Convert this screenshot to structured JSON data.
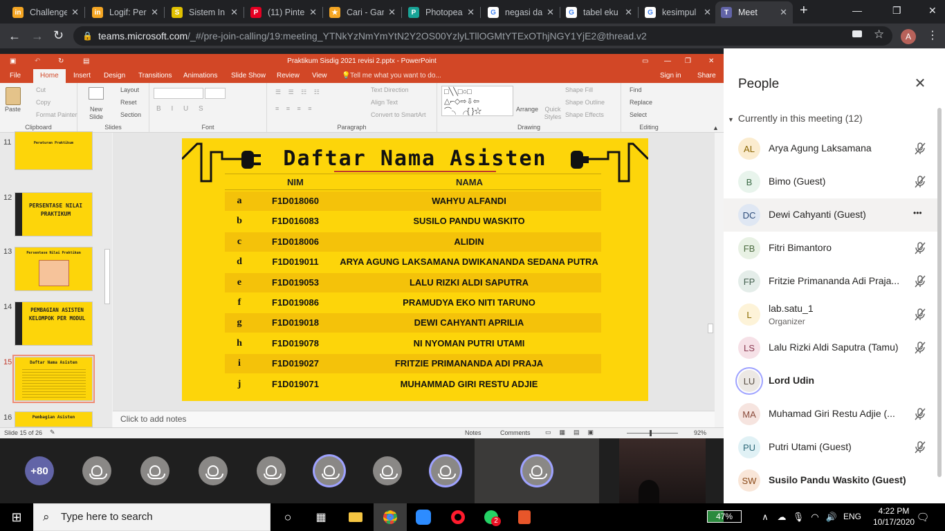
{
  "browser": {
    "tabs": [
      {
        "label": "Challenge",
        "favicon": "in",
        "color": "#f5a623"
      },
      {
        "label": "Logif: Per",
        "favicon": "in",
        "color": "#f5a623"
      },
      {
        "label": "Sistem In",
        "favicon": "S",
        "color": "#e1c100"
      },
      {
        "label": "(11) Pinte",
        "favicon": "P",
        "color": "#e60023"
      },
      {
        "label": "Cari - Gan",
        "favicon": "★",
        "color": "#f5a623"
      },
      {
        "label": "Photopea",
        "favicon": "P",
        "color": "#18a497"
      },
      {
        "label": "negasi da",
        "favicon": "G",
        "color": "#ffffff"
      },
      {
        "label": "tabel eku",
        "favicon": "G",
        "color": "#ffffff"
      },
      {
        "label": "kesimpul",
        "favicon": "G",
        "color": "#ffffff"
      },
      {
        "label": "Meet",
        "favicon": "T",
        "color": "#6264a7"
      }
    ],
    "new_tab": "+",
    "url_host": "teams.microsoft.com",
    "url_path": "/_#/pre-join-calling/19:meeting_YTNkYzNmYmYtN2Y2OS00YzlyLTllOGMtYTExOThjNGY1YjE2@thread.v2",
    "profile_initial": "A"
  },
  "ppt": {
    "title": "Praktikum Sisdig 2021 revisi 2.pptx - PowerPoint",
    "tabs": [
      "File",
      "Home",
      "Insert",
      "Design",
      "Transitions",
      "Animations",
      "Slide Show",
      "Review",
      "View"
    ],
    "tell_me": "Tell me what you want to do...",
    "sign_in": "Sign in",
    "share": "Share",
    "ribbon": {
      "clipboard": {
        "label": "Clipboard",
        "paste": "Paste",
        "cut": "Cut",
        "copy": "Copy",
        "format_painter": "Format Painter"
      },
      "slides": {
        "label": "Slides",
        "new_slide": "New Slide",
        "layout": "Layout",
        "reset": "Reset",
        "section": "Section"
      },
      "font": {
        "label": "Font"
      },
      "paragraph": {
        "label": "Paragraph",
        "text_direction": "Text Direction",
        "align_text": "Align Text",
        "smartart": "Convert to SmartArt"
      },
      "drawing": {
        "label": "Drawing",
        "arrange": "Arrange",
        "quick_styles": "Quick Styles",
        "shape_fill": "Shape Fill",
        "shape_outline": "Shape Outline",
        "shape_effects": "Shape Effects"
      },
      "editing": {
        "label": "Editing",
        "find": "Find",
        "replace": "Replace",
        "select": "Select"
      }
    },
    "thumbnails": [
      {
        "num": "11",
        "title": "Peraturan Praktikum"
      },
      {
        "num": "12",
        "title": "PERSENTASE NILAI PRAKTIKUM"
      },
      {
        "num": "13",
        "title": "Persentase Nilai Praktikum"
      },
      {
        "num": "14",
        "title": "PEMBAGIAN ASISTEN KELOMPOK PER MODUL"
      },
      {
        "num": "15",
        "title": "Daftar Nama Asisten"
      },
      {
        "num": "16",
        "title": "Pembagian Asisten"
      }
    ],
    "slide": {
      "title": "Daftar Nama Asisten",
      "col_nim": "NIM",
      "col_nama": "NAMA",
      "rows": [
        {
          "no": "a",
          "nim": "F1D018060",
          "nama": "WAHYU ALFANDI"
        },
        {
          "no": "b",
          "nim": "F1D016083",
          "nama": "SUSILO PANDU WASKITO"
        },
        {
          "no": "c",
          "nim": "F1D018006",
          "nama": "ALIDIN"
        },
        {
          "no": "d",
          "nim": "F1D019011",
          "nama": "ARYA AGUNG LAKSAMANA DWIKANANDA SEDANA PUTRA"
        },
        {
          "no": "e",
          "nim": "F1D019053",
          "nama": "LALU RIZKI ALDI SAPUTRA"
        },
        {
          "no": "f",
          "nim": "F1D019086",
          "nama": "PRAMUDYA EKO NITI TARUNO"
        },
        {
          "no": "g",
          "nim": "F1D019018",
          "nama": "DEWI CAHYANTI APRILIA"
        },
        {
          "no": "h",
          "nim": "F1D019078",
          "nama": "NI NYOMAN PUTRI UTAMI"
        },
        {
          "no": "i",
          "nim": "F1D019027",
          "nama": "FRITZIE PRIMANANDA ADI PRAJA"
        },
        {
          "no": "j",
          "nim": "F1D019071",
          "nama": "MUHAMMAD GIRI RESTU ADJIE"
        }
      ]
    },
    "notes_placeholder": "Click to add notes",
    "status_slide": "Slide 15 of 26",
    "status_notes": "Notes",
    "status_comments": "Comments",
    "zoom": "92%"
  },
  "strip": {
    "overflow": "+80"
  },
  "people": {
    "title": "People",
    "section": "Currently in this meeting (12)",
    "participants": [
      {
        "initials": "AL",
        "name": "Arya Agung Laksamana",
        "bg": "#fbeccf",
        "fg": "#8a6500",
        "muted": true
      },
      {
        "initials": "B",
        "name": "Bimo (Guest)",
        "bg": "#e8f4ec",
        "fg": "#3b6b45",
        "muted": true
      },
      {
        "initials": "DC",
        "name": "Dewi Cahyanti (Guest)",
        "bg": "#dfe7f3",
        "fg": "#2b4a78",
        "muted": false,
        "more": "•••"
      },
      {
        "initials": "FB",
        "name": "Fitri Bimantoro",
        "bg": "#e8f1e4",
        "fg": "#4b6a3f",
        "muted": true
      },
      {
        "initials": "FP",
        "name": "Fritzie Primananda Adi Praja...",
        "bg": "#e4ede9",
        "fg": "#44604f",
        "muted": true
      },
      {
        "initials": "L",
        "name": "lab.satu_1",
        "sub": "Organizer",
        "bg": "#fdf3d8",
        "fg": "#8a6a00",
        "muted": true
      },
      {
        "initials": "LS",
        "name": "Lalu Rizki Aldi Saputra (Tamu)",
        "bg": "#f6e1e7",
        "fg": "#8a3a52",
        "muted": true
      },
      {
        "initials": "LU",
        "name": "Lord Udin",
        "bg": "#ece8e4",
        "fg": "#5a4f45",
        "muted": false,
        "speaking": true
      },
      {
        "initials": "MA",
        "name": "Muhamad Giri Restu Adjie (...",
        "bg": "#f6e4df",
        "fg": "#8a4a3a",
        "muted": true
      },
      {
        "initials": "PU",
        "name": "Putri Utami (Guest)",
        "bg": "#e0f1f5",
        "fg": "#2d6878",
        "muted": true
      },
      {
        "initials": "SW",
        "name": "Susilo Pandu Waskito (Guest)",
        "bg": "#f9e6d8",
        "fg": "#8a4a1a",
        "muted": false,
        "bold": true
      }
    ]
  },
  "taskbar": {
    "search": "Type here to search",
    "battery": "47%",
    "lang": "ENG",
    "time": "4:22 PM",
    "date": "10/17/2020",
    "whatsapp_badge": "2"
  }
}
